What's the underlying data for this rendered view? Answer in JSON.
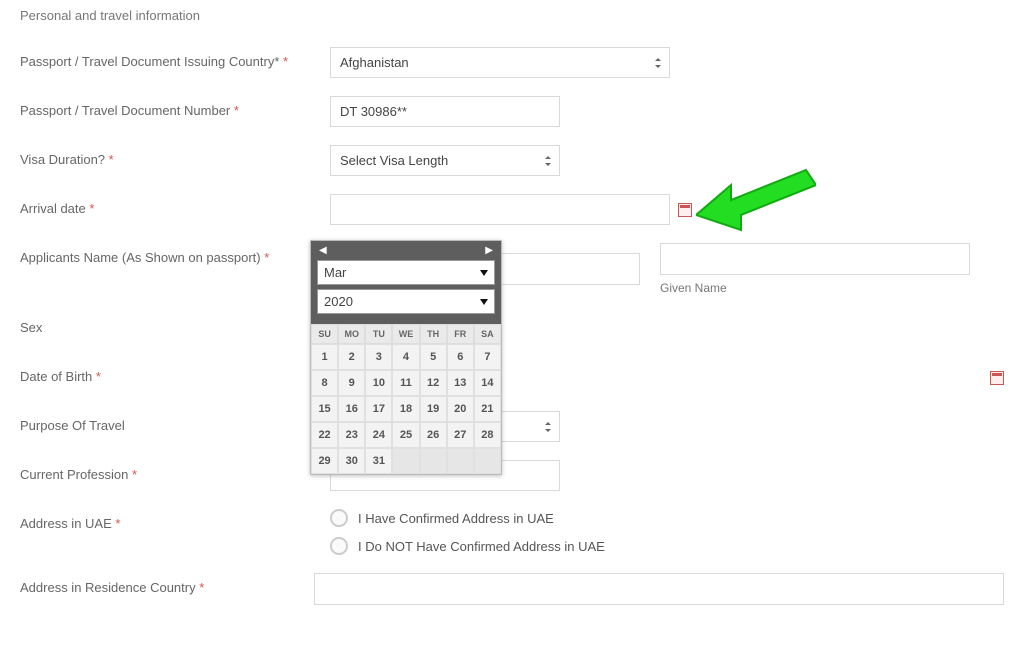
{
  "section_title": "Personal and travel information",
  "labels": {
    "country": "Passport / Travel Document Issuing Country* ",
    "doc_number": "Passport / Travel Document Number ",
    "visa": "Visa Duration? ",
    "arrival": "Arrival date ",
    "applicant": "Applicants Name (As Shown on passport) ",
    "sex": "Sex",
    "dob": "Date of Birth ",
    "purpose": "Purpose Of Travel",
    "profession": "Current Profession ",
    "address_uae": "Address in UAE ",
    "address_res": "Address in Residence Country "
  },
  "values": {
    "country": "Afghanistan",
    "doc_number": "DT 30986**",
    "visa": "Select Visa Length",
    "arrival": "",
    "given_name_label": "Given Name"
  },
  "radios": {
    "confirmed": "I Have Confirmed Address in UAE",
    "not_confirmed": "I Do NOT Have Confirmed Address in UAE"
  },
  "datepicker": {
    "month": "Mar",
    "year": "2020",
    "weekdays": [
      "SU",
      "MO",
      "TU",
      "WE",
      "TH",
      "FR",
      "SA"
    ],
    "prev": "◀",
    "next": "▶",
    "days": [
      [
        1,
        2,
        3,
        4,
        5,
        6,
        7
      ],
      [
        8,
        9,
        10,
        11,
        12,
        13,
        14
      ],
      [
        15,
        16,
        17,
        18,
        19,
        20,
        21
      ],
      [
        22,
        23,
        24,
        25,
        26,
        27,
        28
      ],
      [
        29,
        30,
        31,
        "",
        "",
        "",
        ""
      ]
    ]
  }
}
